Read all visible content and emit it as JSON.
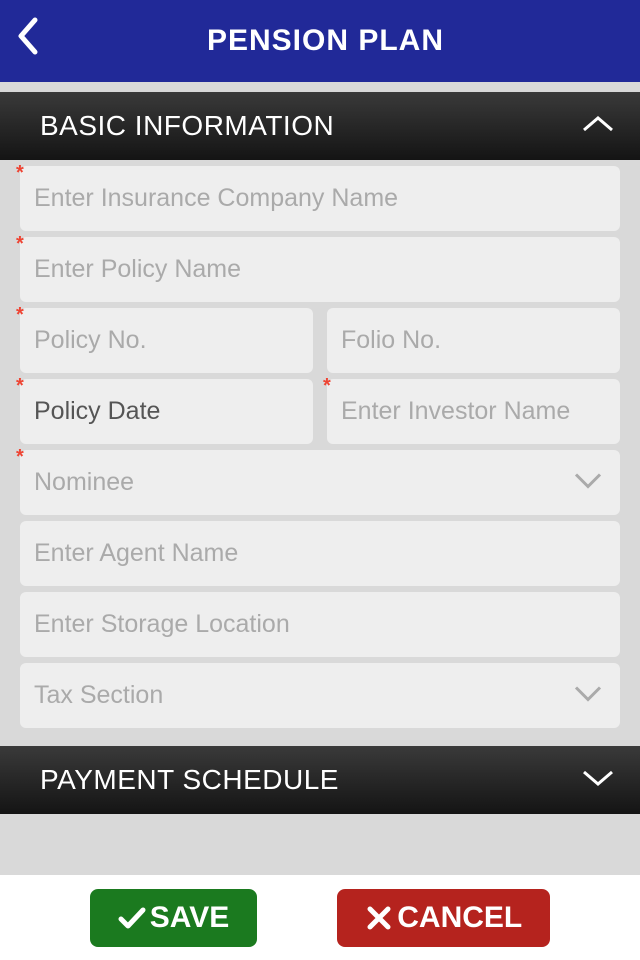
{
  "header": {
    "title": "PENSION PLAN"
  },
  "sections": {
    "basic": {
      "title": "BASIC INFORMATION"
    },
    "payment": {
      "title": "PAYMENT SCHEDULE"
    }
  },
  "fields": {
    "company": {
      "placeholder": "Enter Insurance Company Name",
      "required": true
    },
    "policyName": {
      "placeholder": "Enter Policy Name",
      "required": true
    },
    "policyNo": {
      "placeholder": "Policy No.",
      "required": true
    },
    "folioNo": {
      "placeholder": "Folio No.",
      "required": false
    },
    "policyDate": {
      "placeholder": "Policy Date",
      "required": true
    },
    "investorName": {
      "placeholder": "Enter Investor Name",
      "required": true
    },
    "nominee": {
      "placeholder": "Nominee",
      "required": true
    },
    "agentName": {
      "placeholder": "Enter Agent Name",
      "required": false
    },
    "storageLocation": {
      "placeholder": "Enter Storage Location",
      "required": false
    },
    "taxSection": {
      "placeholder": "Tax Section",
      "required": false
    }
  },
  "buttons": {
    "save": "SAVE",
    "cancel": "CANCEL"
  },
  "asterisk": "*"
}
